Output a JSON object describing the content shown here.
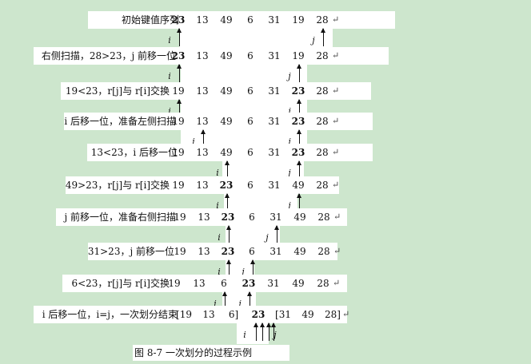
{
  "rows": [
    {
      "label": "初始键值序列",
      "values": [
        "23",
        "13",
        "49",
        "6",
        "31",
        "19",
        "28"
      ],
      "pivot_index": 0,
      "pointers": [
        {
          "name": "i",
          "at": 0
        },
        {
          "name": "j",
          "at": 6
        }
      ]
    },
    {
      "label": "右侧扫描，28>23，j 前移一位",
      "values": [
        "23",
        "13",
        "49",
        "6",
        "31",
        "19",
        "28"
      ],
      "pivot_index": 0,
      "pointers": [
        {
          "name": "i",
          "at": 0
        },
        {
          "name": "j",
          "at": 5
        }
      ]
    },
    {
      "label": "19<23，r[j]与 r[i]交换",
      "values": [
        "19",
        "13",
        "49",
        "6",
        "31",
        "23",
        "28"
      ],
      "pivot_index": 5,
      "pointers": [
        {
          "name": "i",
          "at": 0
        },
        {
          "name": "j",
          "at": 5
        }
      ]
    },
    {
      "label": "i 后移一位，准备左侧扫描",
      "values": [
        "19",
        "13",
        "49",
        "6",
        "31",
        "23",
        "28"
      ],
      "pivot_index": 5,
      "pointers": [
        {
          "name": "i",
          "at": 1
        },
        {
          "name": "j",
          "at": 5
        }
      ]
    },
    {
      "label": "13<23，i 后移一位",
      "values": [
        "19",
        "13",
        "49",
        "6",
        "31",
        "23",
        "28"
      ],
      "pivot_index": 5,
      "pointers": [
        {
          "name": "i",
          "at": 2
        },
        {
          "name": "j",
          "at": 5
        }
      ]
    },
    {
      "label": "49>23，r[j]与 r[i]交换",
      "values": [
        "19",
        "13",
        "23",
        "6",
        "31",
        "49",
        "28"
      ],
      "pivot_index": 2,
      "pointers": [
        {
          "name": "i",
          "at": 2
        },
        {
          "name": "j",
          "at": 5
        }
      ]
    },
    {
      "label": "j 前移一位，准备右侧扫描",
      "values": [
        "19",
        "13",
        "23",
        "6",
        "31",
        "49",
        "28"
      ],
      "pivot_index": 2,
      "pointers": [
        {
          "name": "i",
          "at": 2
        },
        {
          "name": "j",
          "at": 4
        }
      ]
    },
    {
      "label": "31>23，j 前移一位",
      "values": [
        "19",
        "13",
        "23",
        "6",
        "31",
        "49",
        "28"
      ],
      "pivot_index": 2,
      "pointers": [
        {
          "name": "i",
          "at": 2
        },
        {
          "name": "j",
          "at": 3
        }
      ]
    },
    {
      "label": "6<23，r[j]与 r[i]交换",
      "values": [
        "19",
        "13",
        "6",
        "23",
        "31",
        "49",
        "28"
      ],
      "pivot_index": 3,
      "pointers": [
        {
          "name": "i",
          "at": 2
        },
        {
          "name": "j",
          "at": 3
        }
      ]
    },
    {
      "label": "i 后移一位，i=j，一次划分结束",
      "values": [
        "[19",
        "13",
        "6]",
        "23",
        "[31",
        "49",
        "28]"
      ],
      "pivot_index": 3,
      "pointers": [
        {
          "name": "i",
          "at": 3
        },
        {
          "name": "j",
          "at": 3
        }
      ]
    }
  ],
  "return_mark": "↵",
  "caption": "图 8-7   一次划分的过程示例"
}
